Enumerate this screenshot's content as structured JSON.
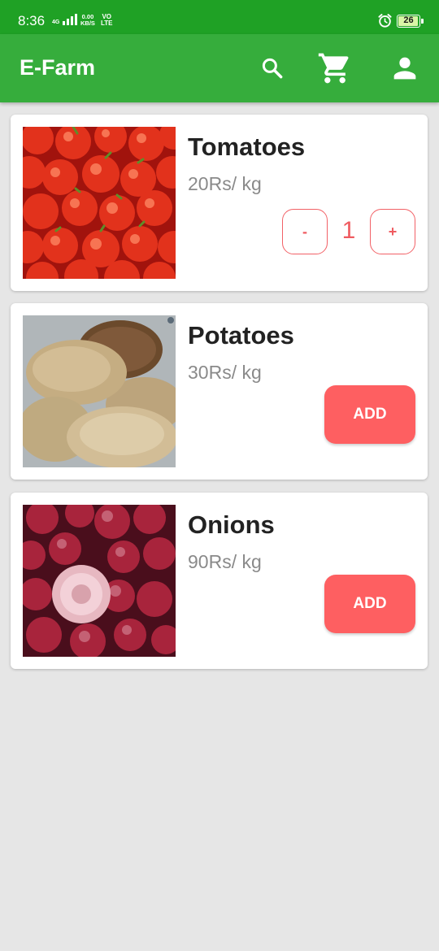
{
  "status_bar": {
    "time": "8:36",
    "network": "4G",
    "speed_value": "0.00",
    "speed_unit": "KB/S",
    "volte_top": "VO",
    "volte_bottom": "LTE",
    "battery_level": "26",
    "icons": [
      "signal-icon",
      "alarm-icon",
      "battery-icon"
    ]
  },
  "app_bar": {
    "title": "E-Farm",
    "icons": [
      "search-icon",
      "cart-icon",
      "account-icon"
    ]
  },
  "products": [
    {
      "name": "Tomatoes",
      "price": "20Rs/ kg",
      "image": "tomatoes-photo",
      "quantity": "1",
      "minus_label": "-",
      "plus_label": "+"
    },
    {
      "name": "Potatoes",
      "price": "30Rs/ kg",
      "image": "potatoes-photo",
      "add_label": "ADD"
    },
    {
      "name": "Onions",
      "price": "90Rs/ kg",
      "image": "onions-photo",
      "add_label": "ADD"
    }
  ],
  "colors": {
    "status_bar": "#1fa125",
    "app_bar": "#36ad3c",
    "accent_red": "#fe5f61",
    "background": "#e6e6e6"
  }
}
